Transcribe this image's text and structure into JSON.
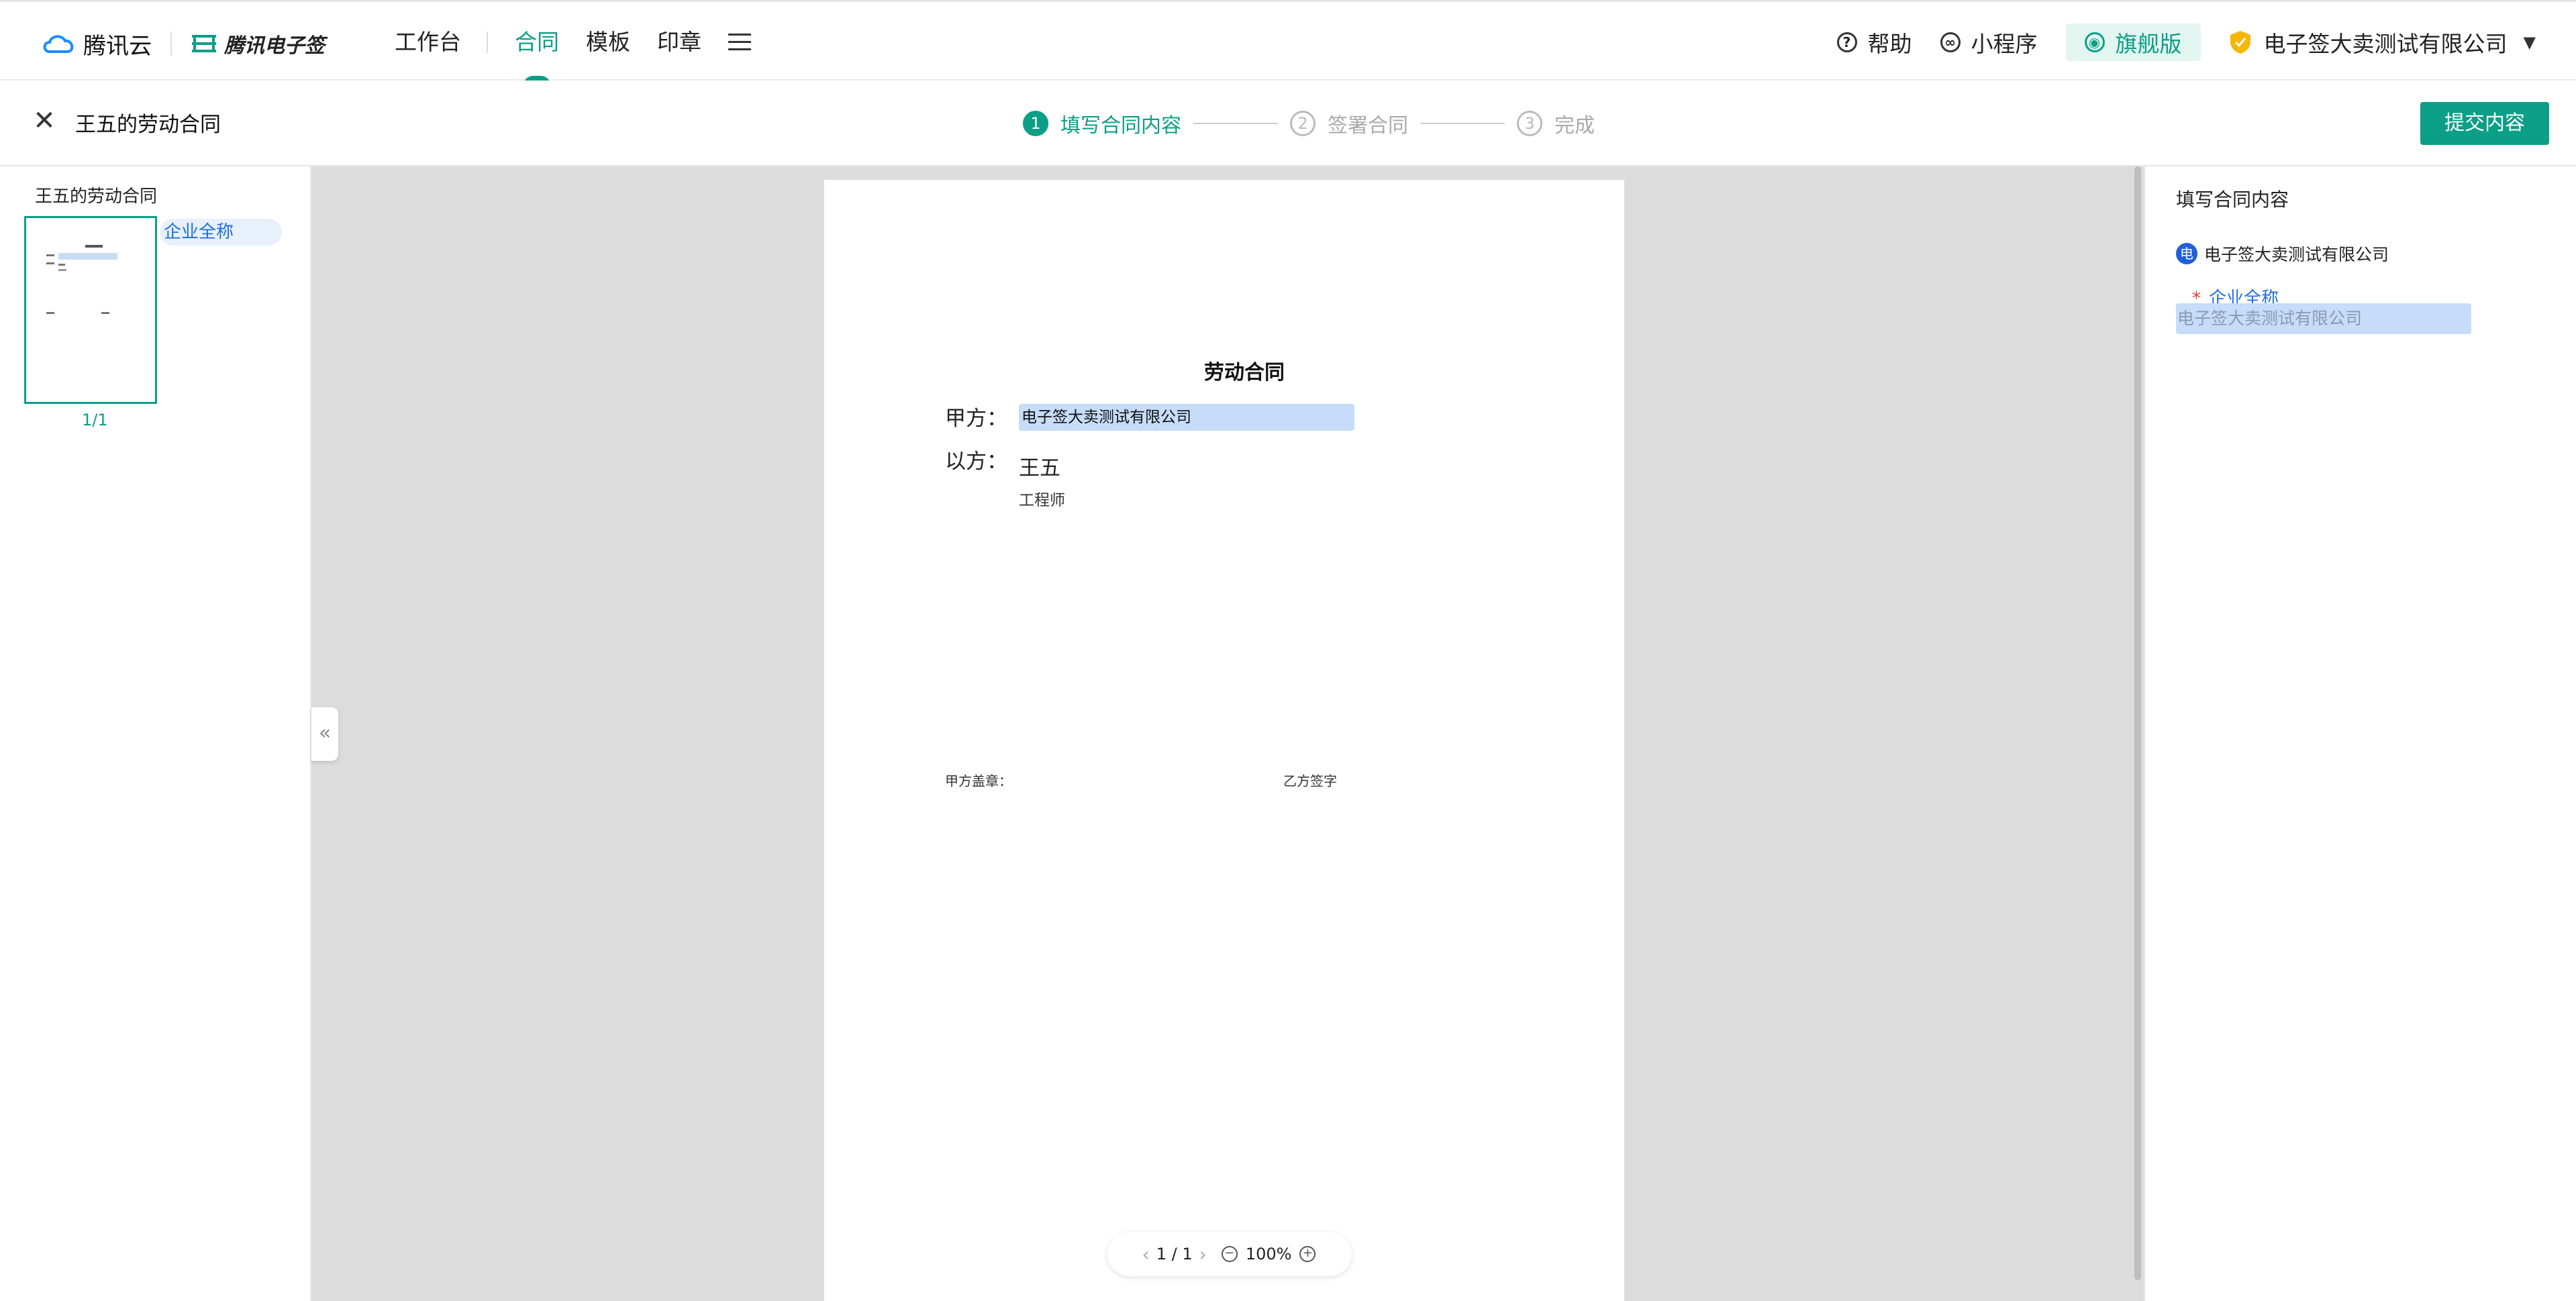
{
  "brand": {
    "cloud": "腾讯云",
    "esign": "腾讯电子签"
  },
  "nav": {
    "workbench": "工作台",
    "contract": "合同",
    "template": "模板",
    "seal": "印章"
  },
  "navright": {
    "help": "帮助",
    "miniprogram": "小程序",
    "flagship": "旗舰版",
    "company": "电子签大卖测试有限公司"
  },
  "subhead": {
    "doc_title": "王五的劳动合同",
    "steps": [
      {
        "num": "1",
        "label": "填写合同内容"
      },
      {
        "num": "2",
        "label": "签署合同"
      },
      {
        "num": "3",
        "label": "完成"
      }
    ],
    "submit": "提交内容"
  },
  "left": {
    "title": "王五的劳动合同",
    "tag": "企业全称",
    "page": "1/1"
  },
  "document": {
    "title": "劳动合同",
    "party_a_label": "甲方：",
    "party_a_value": "电子签大卖测试有限公司",
    "party_b_label": "以方：",
    "party_b_name": "王五",
    "party_b_job": "工程师",
    "sign_a": "甲方盖章：",
    "sign_b": "乙方签字"
  },
  "pager": {
    "page": "1 / 1",
    "zoom": "100%"
  },
  "right": {
    "title": "填写合同内容",
    "org_badge": "电",
    "org": "电子签大卖测试有限公司",
    "field_label": "企业全称",
    "field_value": "电子签大卖测试有限公司"
  },
  "colors": {
    "accent": "#0a9f86",
    "field": "#c6dcf8",
    "link": "#1f6fe0"
  }
}
